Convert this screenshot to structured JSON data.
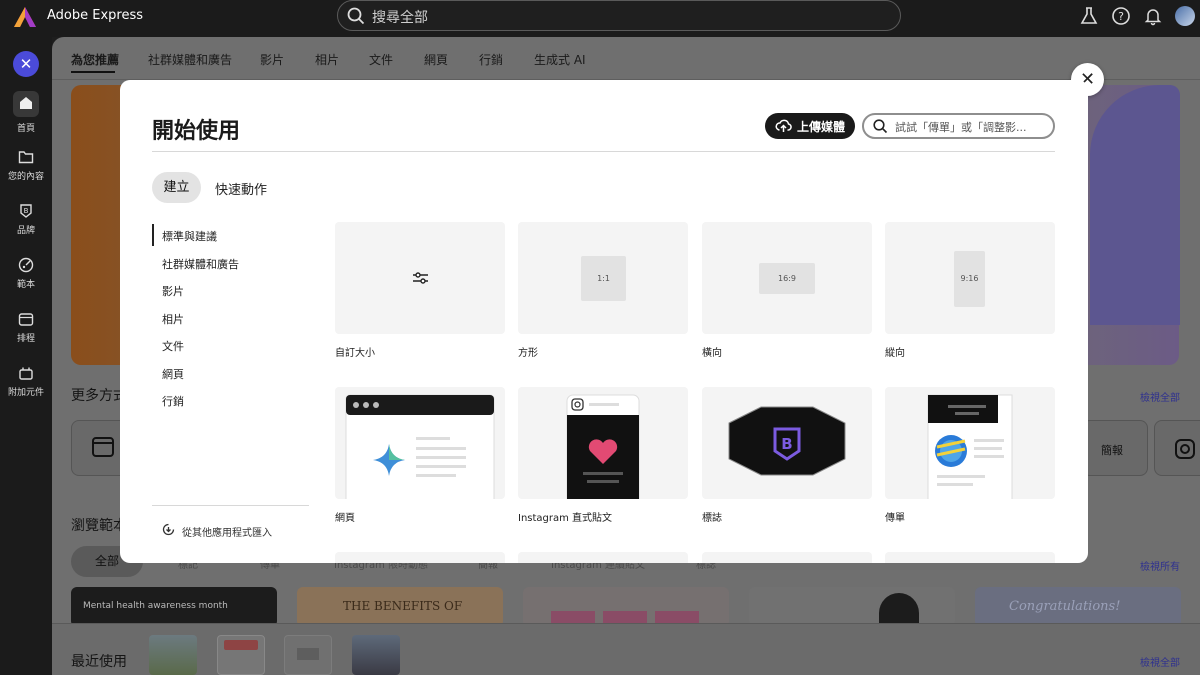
{
  "app": {
    "title": "Adobe Express"
  },
  "topbar": {
    "search_placeholder": "搜尋全部"
  },
  "rail": {
    "items": [
      {
        "label": "首頁",
        "icon": "home-icon"
      },
      {
        "label": "您的內容",
        "icon": "folder-icon"
      },
      {
        "label": "品牌",
        "icon": "brand-icon"
      },
      {
        "label": "範本",
        "icon": "templates-icon"
      },
      {
        "label": "排程",
        "icon": "calendar-icon"
      },
      {
        "label": "附加元件",
        "icon": "addons-icon"
      }
    ]
  },
  "background": {
    "tabs": [
      "為您推薦",
      "社群媒體和廣告",
      "影片",
      "相片",
      "文件",
      "網頁",
      "行銷",
      "生成式 AI"
    ],
    "more_heading": "更多方式",
    "view_all_1": "檢視全部",
    "card_label": "簡報",
    "browse_heading": "瀏覽範本",
    "filter_active": "全部",
    "filters": [
      "標記",
      "傳單",
      "Instagram 限時動態",
      "簡報",
      "Instagram 連續貼文",
      "標誌"
    ],
    "view_all_2": "檢視所有",
    "template_texts": [
      "Mental health awareness month",
      "THE BENEFITS OF",
      "Congratulations!"
    ],
    "recent_heading": "最近使用",
    "view_all_3": "檢視全部"
  },
  "modal": {
    "title": "開始使用",
    "upload_label": "上傳媒體",
    "search_placeholder": "試試「傳單」或「調整影...",
    "segments": {
      "active": "建立",
      "other": "快速動作"
    },
    "categories": [
      "標準與建議",
      "社群媒體和廣告",
      "影片",
      "相片",
      "文件",
      "網頁",
      "行銷"
    ],
    "import_label": "從其他應用程式匯入",
    "tiles": [
      {
        "label": "自訂大小"
      },
      {
        "label": "方形",
        "ratio": "1:1"
      },
      {
        "label": "橫向",
        "ratio": "16:9"
      },
      {
        "label": "縱向",
        "ratio": "9:16"
      },
      {
        "label": "網頁"
      },
      {
        "label": "Instagram 直式貼文"
      },
      {
        "label": "標誌"
      },
      {
        "label": "傳單"
      }
    ]
  },
  "colors": {
    "accent": "#4b4bd9",
    "brand_purple": "#6b4fd6",
    "heart": "#e24a73"
  }
}
